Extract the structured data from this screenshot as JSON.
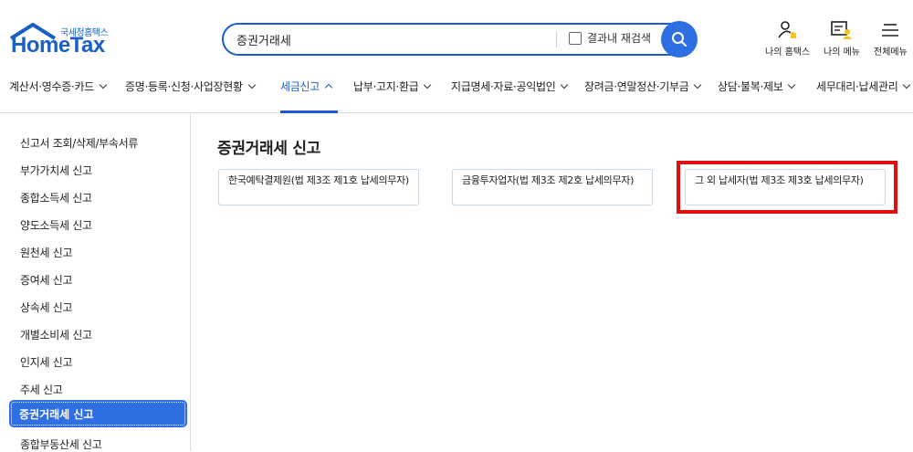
{
  "header": {
    "logo_sub": "국세청홈택스",
    "logo_main": "HomeTax",
    "search": {
      "value": "증권거래세",
      "recheck_label": "결과내 재검색"
    },
    "icons": [
      {
        "name": "my-hometax",
        "label": "나의 홈택스"
      },
      {
        "name": "my-menu",
        "label": "나의 메뉴"
      },
      {
        "name": "all-menu",
        "label": "전체메뉴"
      }
    ]
  },
  "nav": {
    "items": [
      {
        "label": "계산서·영수증·카드"
      },
      {
        "label": "증명·등록·신청·사업장현황"
      },
      {
        "label": "세금신고"
      },
      {
        "label": "납부·고지·환급"
      },
      {
        "label": "지급명세·자료·공익법인"
      },
      {
        "label": "장려금·연말정산·기부금"
      },
      {
        "label": "상담·불복·제보"
      },
      {
        "label": "세무대리·납세관리"
      }
    ],
    "active": "세금신고"
  },
  "sidebar": {
    "items": [
      {
        "label": "신고서 조회/삭제/부속서류"
      },
      {
        "label": "부가가치세 신고"
      },
      {
        "label": "종합소득세 신고"
      },
      {
        "label": "양도소득세 신고"
      },
      {
        "label": "원천세 신고"
      },
      {
        "label": "증여세 신고"
      },
      {
        "label": "상속세 신고"
      },
      {
        "label": "개별소비세 신고"
      },
      {
        "label": "인지세 신고"
      },
      {
        "label": "주세 신고"
      },
      {
        "label": "증권거래세 신고"
      },
      {
        "label": "종합부동산세 신고"
      }
    ],
    "active_index": 10
  },
  "main": {
    "title": "증권거래세 신고",
    "options": [
      {
        "label": "한국예탁결제원(법 제3조 제1호 납세의무자)"
      },
      {
        "label": "금융투자업자(법 제3조 제2호 납세의무자)"
      },
      {
        "label": "그 외 납세자(법 제3조 제3호 납세의무자)"
      }
    ],
    "highlighted_option": 2
  },
  "colors": {
    "brand": "#1d5bd0",
    "accent": "#2f6fe4",
    "highlight": "#e01010"
  }
}
